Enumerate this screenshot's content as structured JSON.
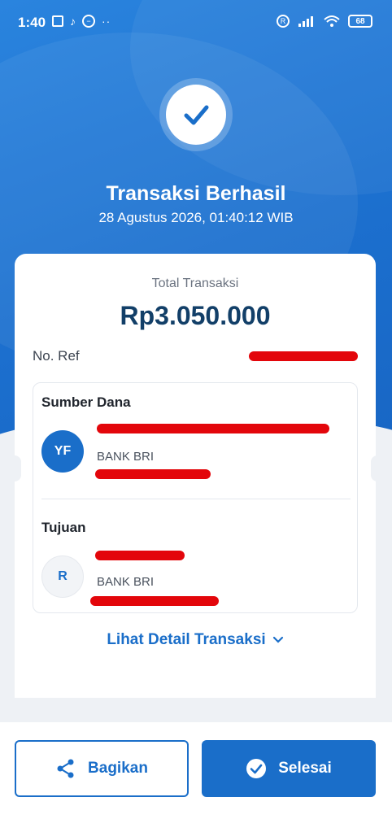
{
  "status_bar": {
    "time": "1:40",
    "battery": "68",
    "overflow_dots": "··"
  },
  "header": {
    "title": "Transaksi Berhasil",
    "datetime": "28 Agustus 2026, 01:40:12 WIB"
  },
  "summary": {
    "total_label": "Total Transaksi",
    "total_amount": "Rp3.050.000",
    "ref_label": "No. Ref"
  },
  "source": {
    "section_title": "Sumber Dana",
    "avatar_initials": "YF",
    "bank": "BANK BRI"
  },
  "destination": {
    "section_title": "Tujuan",
    "avatar_initials": "R",
    "bank": "BANK BRI"
  },
  "detail_link": "Lihat Detail Transaksi",
  "actions": {
    "share_label": "Bagikan",
    "done_label": "Selesai"
  },
  "colors": {
    "primary": "#1a6ec9",
    "redaction": "#e3060b"
  }
}
